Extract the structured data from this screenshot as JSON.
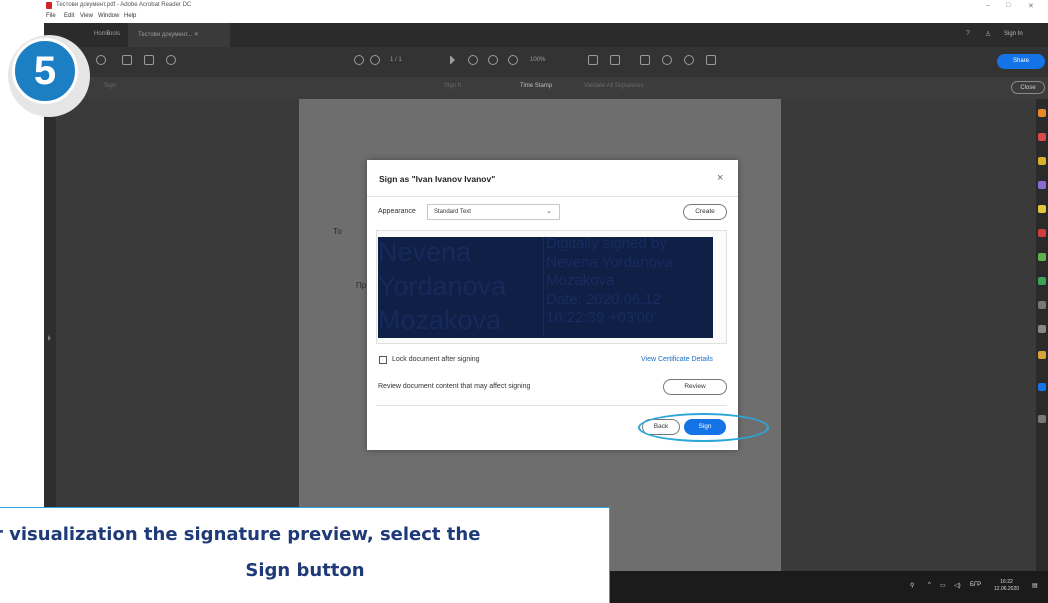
{
  "window": {
    "title": "Тестови документ.pdf - Adobe Acrobat Reader DC",
    "controls": [
      "–",
      "□",
      "✕"
    ]
  },
  "menu": [
    "File",
    "Edit",
    "View",
    "Window",
    "Help"
  ],
  "tabs": {
    "home": "Home",
    "tools": "Tools",
    "document": "Тестови документ... ✕",
    "sign_in": "Sign In"
  },
  "toolbar": {
    "page_indicator": "1 / 1",
    "zoom": "100%",
    "share": "Share"
  },
  "signbar": {
    "sign_label": "Sign",
    "items": [
      "Sign It",
      "Time Stamp",
      "Validate All Signatures"
    ],
    "close": "Close"
  },
  "page_text": {
    "line1": "То",
    "line2": "Пр"
  },
  "dialog": {
    "title": "Sign as \"Ivan Ivanov Ivanov\"",
    "close_symbol": "×",
    "appearance_label": "Appearance",
    "appearance_value": "Standard Text",
    "create_label": "Create",
    "signature_name_lines": [
      "Nevena",
      "Yordanova",
      "Mozakova"
    ],
    "signature_detail_lines": [
      "Digitally signed by",
      "Nevena Yordanova",
      "Mozakova",
      "Date: 2020.06.12",
      "16:22:39 +03'00'"
    ],
    "lock_label": "Lock document after signing",
    "lock_checked": false,
    "view_cert_label": "View Certificate Details",
    "review_text": "Review document content that may affect signing",
    "review_label": "Review",
    "back_label": "Back",
    "sign_label": "Sign"
  },
  "taskbar": {
    "lang": "БГР",
    "time": "16:22",
    "date": "12.06.2020"
  },
  "overlay": {
    "step_number": "5",
    "caption_line1": "r visualization the signature preview, select the",
    "caption_line2": "Sign button",
    "accent_color": "#2aa7d8",
    "badge_color": "#1c7fc4"
  }
}
